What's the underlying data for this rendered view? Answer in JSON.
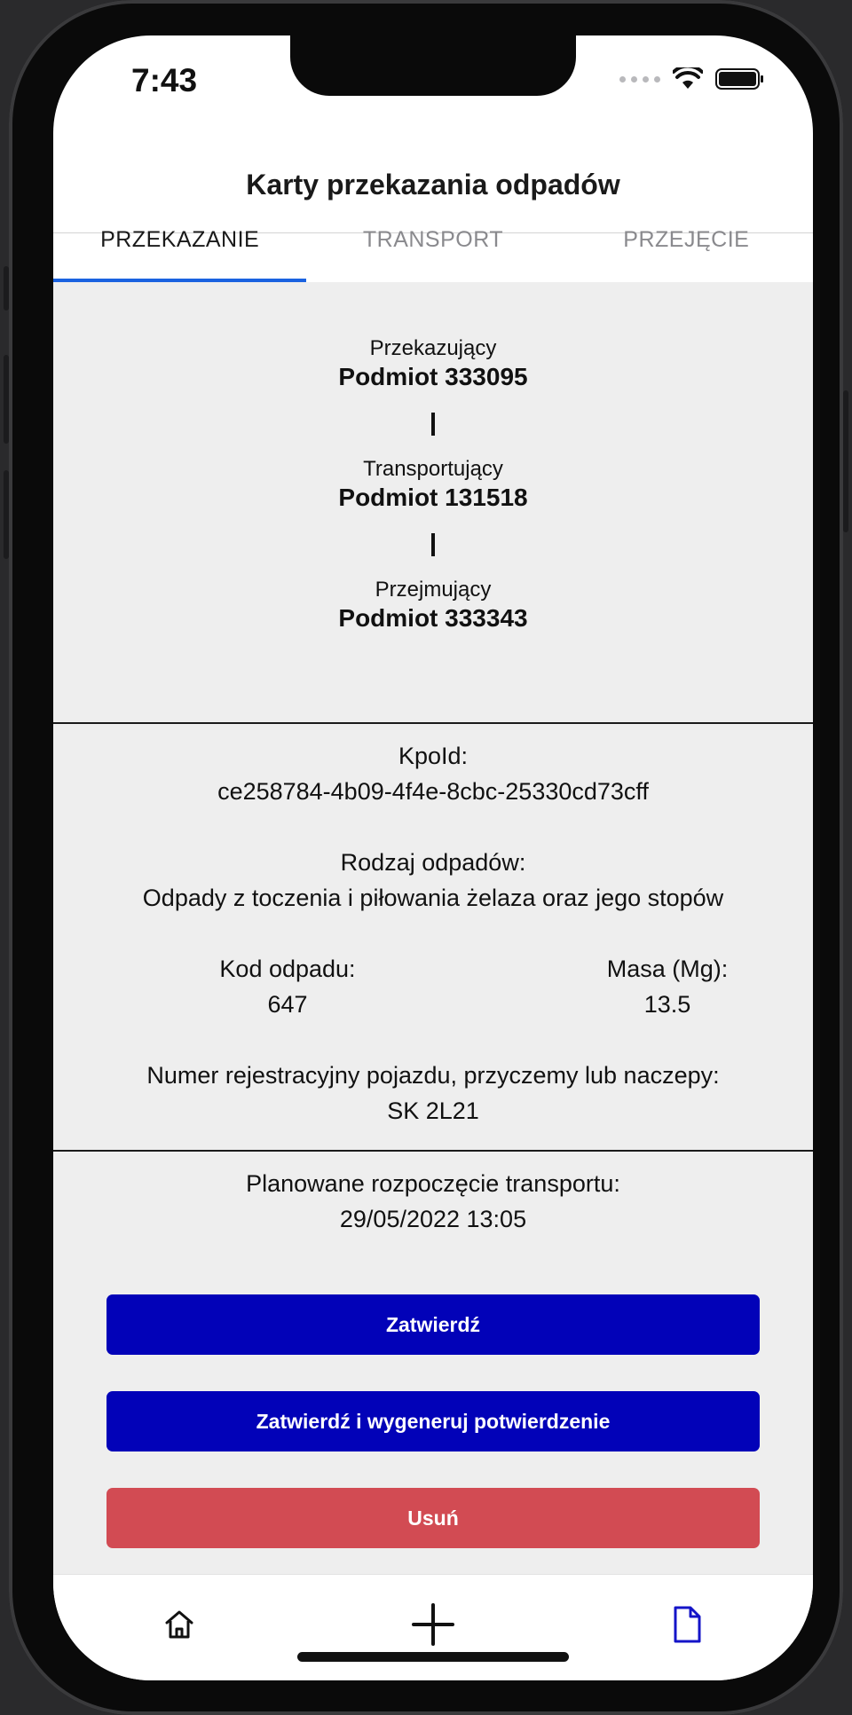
{
  "status_bar": {
    "time": "7:43"
  },
  "header": {
    "title": "Karty przekazania odpadów"
  },
  "tabs": [
    {
      "label": "PRZEKAZANIE",
      "active": true
    },
    {
      "label": "TRANSPORT",
      "active": false
    },
    {
      "label": "PRZEJĘCIE",
      "active": false
    }
  ],
  "parties": [
    {
      "role": "Przekazujący",
      "name": "Podmiot 333095"
    },
    {
      "role": "Transportujący",
      "name": "Podmiot 131518"
    },
    {
      "role": "Przejmujący",
      "name": "Podmiot 333343"
    }
  ],
  "details": {
    "kpo_label": "KpoId:",
    "kpo_value": "ce258784-4b09-4f4e-8cbc-25330cd73cff",
    "waste_type_label": "Rodzaj odpadów:",
    "waste_type_value": "Odpady z toczenia i piłowania żelaza oraz jego stopów",
    "waste_code_label": "Kod odpadu:",
    "waste_code_value": "647",
    "mass_label": "Masa (Mg):",
    "mass_value": "13.5",
    "registration_label": "Numer rejestracyjny pojazdu, przyczemy lub naczepy:",
    "registration_value": "SK 2L21"
  },
  "schedule": {
    "planned_start_label": "Planowane rozpoczęcie transportu:",
    "planned_start_value": "29/05/2022 13:05"
  },
  "actions": {
    "confirm": "Zatwierdź",
    "confirm_generate": "Zatwierdź i wygeneruj potwierdzenie",
    "delete": "Usuń"
  },
  "bottom_nav": [
    {
      "icon": "home-icon",
      "active": false
    },
    {
      "icon": "plus-icon",
      "active": false
    },
    {
      "icon": "document-icon",
      "active": true
    }
  ],
  "colors": {
    "accent_tab": "#1a62e0",
    "primary_button": "#0202b8",
    "danger_button": "#d24b53",
    "active_nav": "#1414c8"
  }
}
